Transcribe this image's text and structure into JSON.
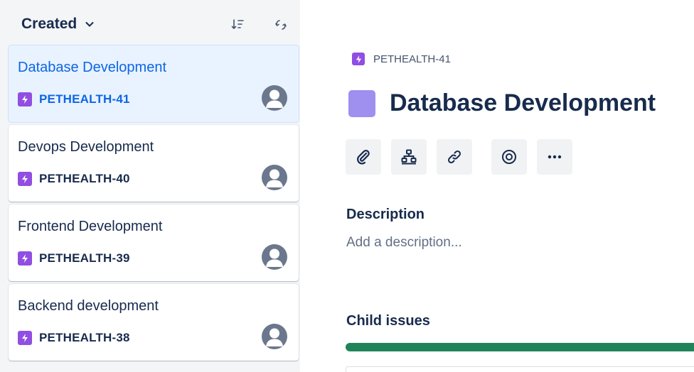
{
  "list": {
    "sort_label": "Created",
    "sort_icon": "sort-descending-icon",
    "refresh_icon": "refresh-icon",
    "items": [
      {
        "title": "Database Development",
        "key": "PETHEALTH-41",
        "selected": true
      },
      {
        "title": "Devops Development",
        "key": "PETHEALTH-40",
        "selected": false
      },
      {
        "title": "Frontend Development",
        "key": "PETHEALTH-39",
        "selected": false
      },
      {
        "title": "Backend development",
        "key": "PETHEALTH-38",
        "selected": false
      }
    ]
  },
  "detail": {
    "breadcrumb_key": "PETHEALTH-41",
    "title": "Database Development",
    "toolbar_icons": [
      "attachment-icon",
      "child-issue-icon",
      "link-icon",
      "watch-icon",
      "more-icon"
    ],
    "description_heading": "Description",
    "description_placeholder": "Add a description...",
    "child_issues_heading": "Child issues",
    "child_issues_progress": 1.0
  },
  "colors": {
    "accent": "#0c66e4",
    "epic": "#904ee2",
    "selected_bg": "#e9f2ff",
    "progress": "#1f845a",
    "title_swatch": "#9f8fef"
  }
}
